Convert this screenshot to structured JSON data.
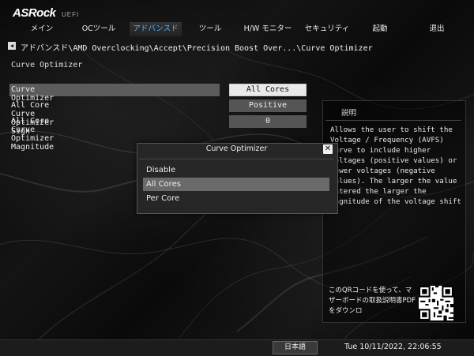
{
  "header": {
    "logo": "ASRock",
    "logo_sub": "UEFI"
  },
  "nav": {
    "tabs": [
      {
        "label": "メイン"
      },
      {
        "label": "OCツール"
      },
      {
        "label": "アドバンスド"
      },
      {
        "label": "ツール"
      },
      {
        "label": "H/W モニター"
      },
      {
        "label": "セキュリティ"
      },
      {
        "label": "起動"
      },
      {
        "label": "退出"
      }
    ],
    "active_index": 2,
    "active_color": "#4fb4ff"
  },
  "breadcrumb": "アドバンスド\\AMD Overclocking\\Accept\\Precision Boost Over...\\Curve Optimizer",
  "page_title": "Curve Optimizer",
  "settings": [
    {
      "label": "Curve Optimizer",
      "value": "All Cores"
    },
    {
      "label": "All Core Curve Optimizer Sign",
      "value": "Positive"
    },
    {
      "label": "All Core Curve Optimizer Magnitude",
      "value": "0"
    }
  ],
  "help": {
    "title": "説明",
    "text": "Allows the user to shift the Voltage / Frequency (AVFS) curve to include higher voltages (positive values) or lower voltages (negative values). The larger the value entered the larger the magnitude of the voltage shift",
    "qr_text": "このQRコードを使って、マザーボードの取扱説明書PDFをダウンロ"
  },
  "popup": {
    "title": "Curve Optimizer",
    "close_icon": "close-icon",
    "options": [
      "Disable",
      "All Cores",
      "Per Core"
    ],
    "selected_index": 1
  },
  "footer": {
    "language": "日本語",
    "datetime": "Tue 10/11/2022, 22:06:55"
  }
}
